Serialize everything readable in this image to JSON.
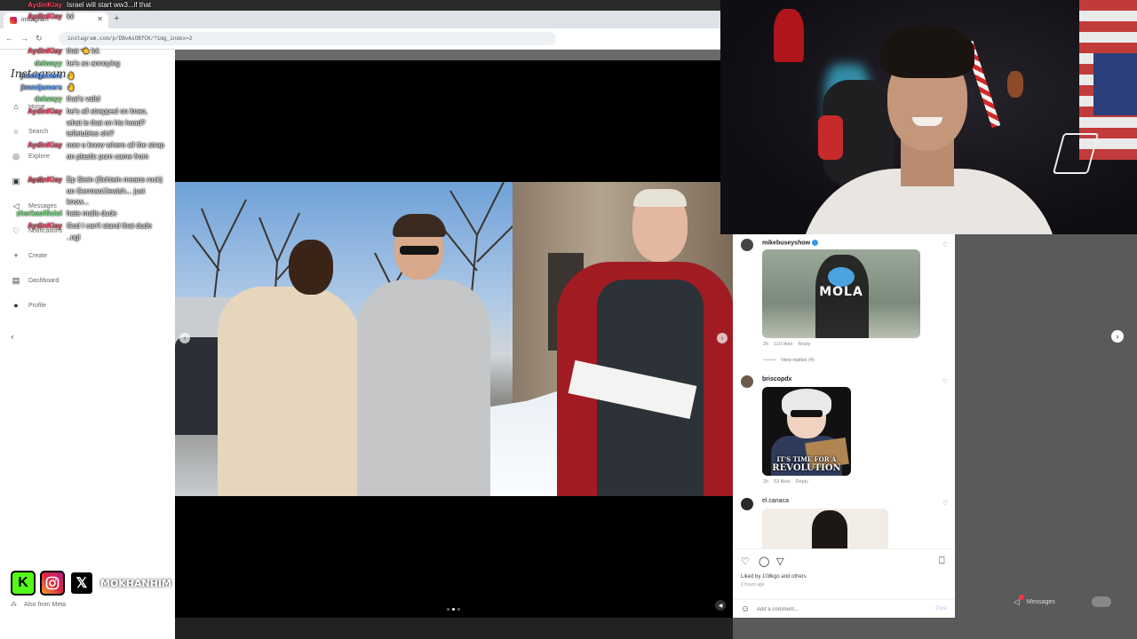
{
  "browser": {
    "tab_title": "instagram",
    "url": "instagram.com/p/DBvAsOBfCK/?img_index=2"
  },
  "instagram": {
    "logo": "Instagram",
    "nav": [
      {
        "label": "Home",
        "icon": "home-icon",
        "glyph": "⌂"
      },
      {
        "label": "Search",
        "icon": "search-icon",
        "glyph": "○"
      },
      {
        "label": "Explore",
        "icon": "compass-icon",
        "glyph": "◎"
      },
      {
        "label": "Reels",
        "icon": "reels-icon",
        "glyph": "▣"
      },
      {
        "label": "Messages",
        "icon": "messages-icon",
        "glyph": "◁"
      },
      {
        "label": "Notifications",
        "icon": "heart-icon",
        "glyph": "♡"
      },
      {
        "label": "Create",
        "icon": "plus-icon",
        "glyph": "+"
      },
      {
        "label": "Dashboard",
        "icon": "dashboard-icon",
        "glyph": "▤"
      },
      {
        "label": "Profile",
        "icon": "avatar",
        "glyph": "●"
      }
    ],
    "also_from_meta": "Also from Meta"
  },
  "chat": [
    {
      "user": "AydinKlay",
      "color": "red",
      "text": "Israel will start ww3...if that"
    },
    {
      "user": "AydinKlay",
      "color": "red",
      "text": "lol"
    },
    {
      "user": "AydinKlay",
      "color": "red",
      "text": "that 👈 lol."
    },
    {
      "user": "delwayy",
      "color": "green",
      "text": "he's so annoying"
    },
    {
      "user": "jimmijamers",
      "color": "blue",
      "text": "🤚"
    },
    {
      "user": "jimmijamers",
      "color": "blue",
      "text": "🤚"
    },
    {
      "user": "delwayy",
      "color": "green",
      "text": "that's valid"
    },
    {
      "user": "AydinKlay",
      "color": "red",
      "text": "he's all strapped on lmao, what is that on his head? telletubies sht?"
    },
    {
      "user": "AydinKlay",
      "color": "red",
      "text": "now u know where all the strap on plastic porn came from"
    },
    {
      "user": "AydinKlay",
      "color": "red",
      "text": "Ep Stein (Schtein means rock) on German/Jewish... just know..."
    },
    {
      "user": "zherkaofficiol",
      "color": "green",
      "text": "hate malis dude"
    },
    {
      "user": "AydinKlay",
      "color": "red",
      "text": "God I can't stand that dude ..ngl"
    }
  ],
  "socials": {
    "kick_letter": "K",
    "x_letter": "𝕏",
    "handle": "MOKHANHIM"
  },
  "comments": [
    {
      "user": "mikebuseyshow",
      "verified": true,
      "image_text": "MOLA",
      "time": "2h",
      "likes": "110 likes",
      "reply": "Reply",
      "view_replies": "View replies (4)"
    },
    {
      "user": "briscopdx",
      "verified": false,
      "image_text_1": "IT'S TIME FOR A",
      "image_text_2": "REVOLUTION",
      "time": "2h",
      "likes": "53 likes",
      "reply": "Reply"
    },
    {
      "user": "el.canaca",
      "verified": false
    }
  ],
  "post_actions": {
    "liked_by": "Liked by 108kgo and others",
    "time_ago": "2 hours ago",
    "comment_placeholder": "Add a comment...",
    "post_label": "Post"
  },
  "messages_pill": {
    "label": "Messages"
  },
  "carousel": {
    "slide_count": 3,
    "active_slide": 2
  }
}
